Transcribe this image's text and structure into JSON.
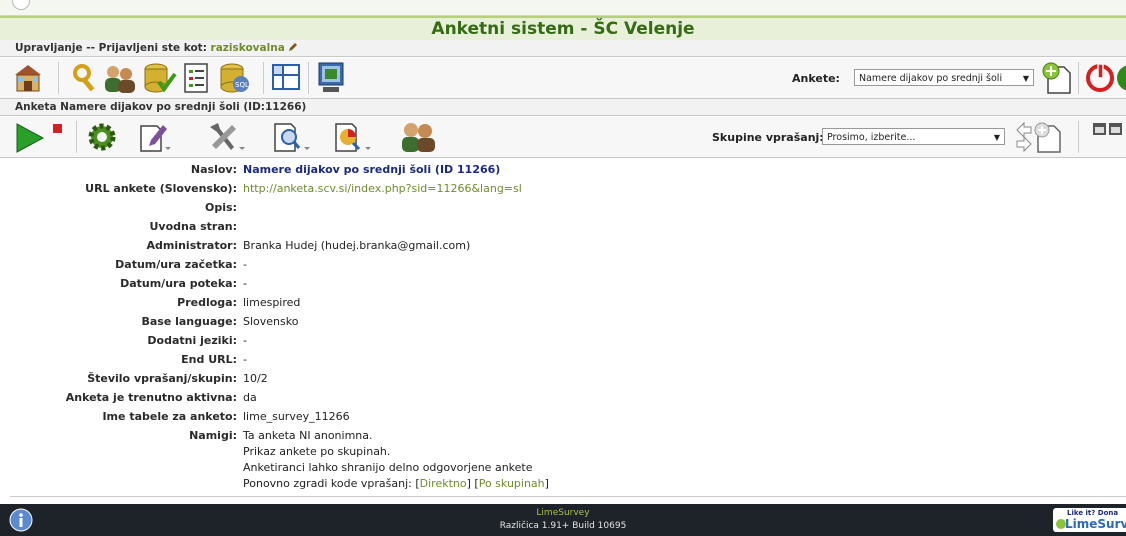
{
  "app_title": "Anketni sistem - ŠC Velenje",
  "admin_bar": {
    "prefix": "Upravljanje -- Prijavljeni ste kot:",
    "username": "raziskovalna"
  },
  "main_toolbar": {
    "survey_label": "Ankete:",
    "survey_selected": "Namere dijakov po srednji šoli",
    "icons": [
      "home-icon",
      "users-icon",
      "user-groups-icon",
      "data-check-icon",
      "label-sets-icon",
      "sql-icon",
      "templates-icon",
      "layout-icon",
      "add-survey-icon",
      "logout-icon"
    ]
  },
  "survey_bar": {
    "title": "Anketa Namere dijakov po srednji šoli (ID:11266)"
  },
  "survey_toolbar": {
    "groups_label": "Skupine vprašanj:",
    "groups_selected": "Prosimo, izberite...",
    "icons": [
      "activate-icon",
      "settings-icon",
      "edit-icon",
      "tools-icon",
      "browse-responses-icon",
      "statistics-icon",
      "participants-icon",
      "add-group-icon",
      "minimize-icon"
    ]
  },
  "details": {
    "naslov_label": "Naslov:",
    "naslov_value": "Namere dijakov po srednji šoli (ID 11266)",
    "url_label": "URL ankete (Slovensko):",
    "url_value": "http://anketa.scv.si/index.php?sid=11266&lang=sl",
    "opis_label": "Opis:",
    "uvodna_label": "Uvodna stran:",
    "admin_label": "Administrator:",
    "admin_value": "Branka Hudej (hudej.branka@gmail.com)",
    "start_label": "Datum/ura začetka:",
    "start_value": "-",
    "end_label": "Datum/ura poteka:",
    "end_value": "-",
    "template_label": "Predloga:",
    "template_value": "limespired",
    "baselang_label": "Base language:",
    "baselang_value": "Slovensko",
    "addlang_label": "Dodatni jeziki:",
    "addlang_value": "-",
    "endurl_label": "End URL:",
    "endurl_value": "-",
    "count_label": "Število vprašanj/skupin:",
    "count_value": "10/2",
    "active_label": "Anketa je trenutno aktivna:",
    "active_value": "da",
    "table_label": "Ime tabele za anketo:",
    "table_value": "lime_survey_11266",
    "hints_label": "Namigi:",
    "hint1": "Ta anketa NI anonimna.",
    "hint2": "Prikaz ankete po skupinah.",
    "hint3": "Anketiranci lahko shranijo delno odgovorjene ankete",
    "hint4_prefix": "Ponovno zgradi kode vprašanj:",
    "hint4_link1": "Direktno",
    "hint4_link2": "Po skupinah"
  },
  "footer": {
    "product": "LimeSurvey",
    "version": "Različica 1.91+ Build 10695",
    "donate_top": "Like it? Dona",
    "donate_logo": "LimeSurv"
  }
}
